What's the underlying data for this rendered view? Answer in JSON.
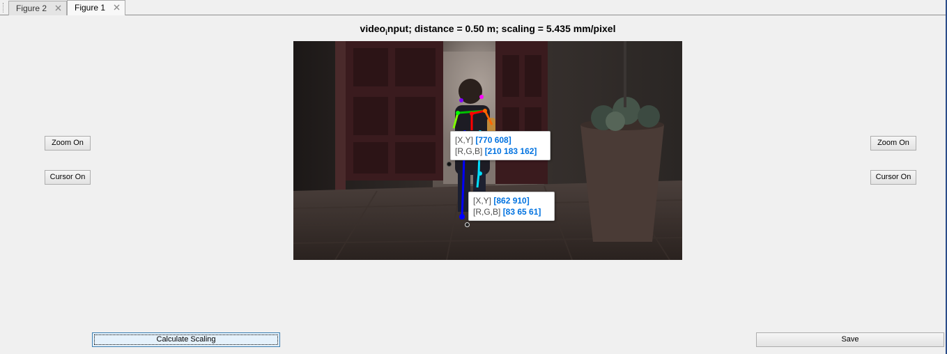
{
  "tabs": [
    {
      "label": "Figure 2",
      "active": false
    },
    {
      "label": "Figure 1",
      "active": true
    }
  ],
  "plot": {
    "title_prefix": "video",
    "title_sub": "i",
    "title_suffix": "nput; distance = 0.50 m; scaling = 5.435 mm/pixel"
  },
  "datatips": [
    {
      "xy_label": "[X,Y]",
      "xy_value": "[770 608]",
      "rgb_label": "[R,G,B]",
      "rgb_value": "[210 183 162]"
    },
    {
      "xy_label": "[X,Y]",
      "xy_value": "[862 910]",
      "rgb_label": "[R,G,B]",
      "rgb_value": "[83 65 61]"
    }
  ],
  "left_panel": {
    "zoom_label": "Zoom On",
    "cursor_label": "Cursor On"
  },
  "right_panel": {
    "zoom_label": "Zoom On",
    "cursor_label": "Cursor On"
  },
  "bottom": {
    "calculate_label": "Calculate Scaling",
    "save_label": "Save"
  },
  "colors": {
    "datatip_value": "#0072e0",
    "skeleton": [
      "#00c000",
      "#ff0000",
      "#ff6600",
      "#0000ff",
      "#00e0ff",
      "#ff00ff",
      "#8000ff",
      "#00ff80"
    ]
  }
}
